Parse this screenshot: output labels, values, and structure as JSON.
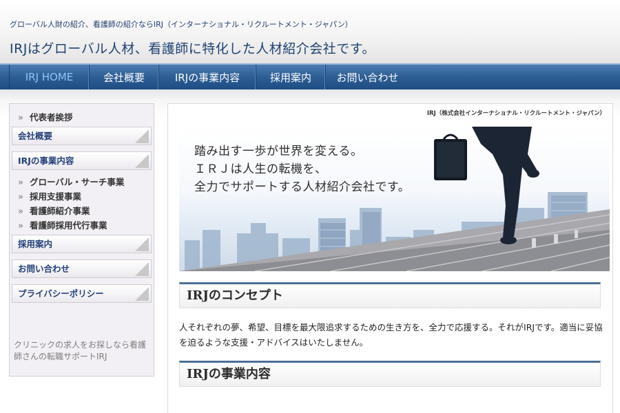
{
  "header": {
    "tagline": "グローバル人財の紹介、看護師の紹介ならIRJ（インターナショナル・リクルートメント・ジャパン）",
    "title": "IRJはグローバル人材、看護師に特化した人材紹介会社です。"
  },
  "nav": {
    "items": [
      {
        "label": "IRJ HOME",
        "active": true
      },
      {
        "label": "会社概要"
      },
      {
        "label": "IRJの事業内容"
      },
      {
        "label": "採用案内"
      },
      {
        "label": "お問い合わせ"
      }
    ]
  },
  "sidebar": {
    "greeting": "代表者挨拶",
    "company": "会社概要",
    "business": "IRJの事業内容",
    "business_items": [
      "グローバル・サーチ事業",
      "採用支援事業",
      "看護師紹介事業",
      "看護師採用代行事業"
    ],
    "recruit": "採用案内",
    "contact": "お問い合わせ",
    "privacy": "プライバシーポリシー",
    "note": "クリニックの求人をお探しなら看護師さんの転職サポートIRJ"
  },
  "main": {
    "company_name": "IRJ（株式会社インターナショナル・リクルートメント・ジャパン）",
    "hero": {
      "line1": "踏み出す一歩が世界を変える。",
      "line2": "ＩＲＪは人生の転機を、",
      "line3": "全力でサポートする人材紹介会社です。"
    },
    "concept_title": "IRJのコンセプト",
    "concept_text": "人それぞれの夢、希望、目標を最大限追求するための生き方を、全力で応援する。それがIRJです。適当に妥協を迫るような支援・アドバイスはいたしません。",
    "business_title": "IRJの事業内容"
  },
  "colors": {
    "nav": "#2c5d93",
    "nav_active_text": "#8fc7f5",
    "title": "#1e4272",
    "sidebar_bg": "#f3f0f5"
  },
  "icons": [
    "chevron-right-icon",
    "corner-triangle-icon"
  ]
}
